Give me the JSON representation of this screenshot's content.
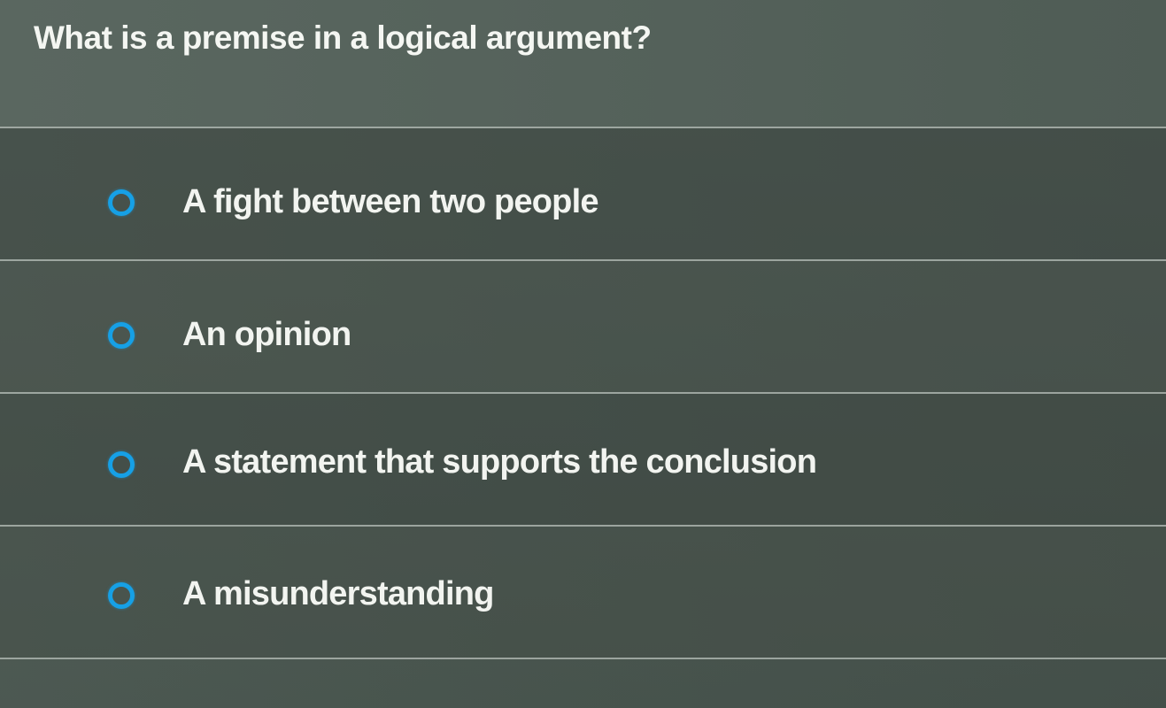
{
  "question": {
    "text": "What is a premise in a logical argument?"
  },
  "options": [
    {
      "label": "A fight between two people",
      "selected": false
    },
    {
      "label": "An opinion",
      "selected": false
    },
    {
      "label": "A statement that supports the conclusion",
      "selected": false
    },
    {
      "label": "A misunderstanding",
      "selected": false
    }
  ],
  "colors": {
    "radio_accent": "#16a0e6",
    "text": "#f2f4f0",
    "background": "#4a564f",
    "divider": "#aab3ad"
  }
}
